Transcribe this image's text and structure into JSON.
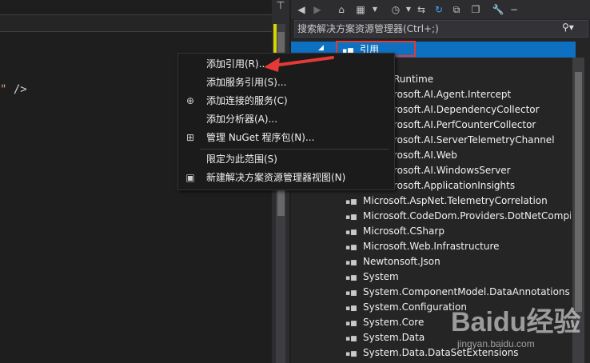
{
  "editor": {
    "code_tail": "\" />",
    "quote": "\"",
    "tag_close": "/>"
  },
  "splitter": {
    "pin_glyph": "⊤"
  },
  "toolbar": {
    "icons": [
      "back-icon",
      "forward-icon",
      "home-icon",
      "dropdown-icon",
      "history-icon",
      "sync-icon",
      "refresh-icon",
      "collapse-icon",
      "copy-icon",
      "wrench-icon",
      "minimize-icon"
    ]
  },
  "search": {
    "placeholder": "搜索解决方案资源管理器(Ctrl+;)"
  },
  "tree": {
    "selected": "引用",
    "items": [
      "Runtime",
      "rosoft.AI.Agent.Intercept",
      "rosoft.AI.DependencyCollector",
      "rosoft.AI.PerfCounterCollector",
      "rosoft.AI.ServerTelemetryChannel",
      "rosoft.AI.Web",
      "rosoft.AI.WindowsServer",
      "rosoft.ApplicationInsights",
      "Microsoft.AspNet.TelemetryCorrelation",
      "Microsoft.CodeDom.Providers.DotNetCompi",
      "Microsoft.CSharp",
      "Microsoft.Web.Infrastructure",
      "Newtonsoft.Json",
      "System",
      "System.ComponentModel.DataAnnotations",
      "System.Configuration",
      "System.Core",
      "System.Data",
      "System.Data.DataSetExtensions"
    ]
  },
  "menu": {
    "items": [
      {
        "label": "添加引用(R)...",
        "icon": ""
      },
      {
        "label": "添加服务引用(S)...",
        "icon": ""
      },
      {
        "label": "添加连接的服务(C)",
        "icon": "connected-service-icon"
      },
      {
        "label": "添加分析器(A)...",
        "icon": ""
      },
      {
        "label": "管理 NuGet 程序包(N)...",
        "icon": "nuget-icon"
      },
      {
        "label": "限定为此范围(S)",
        "icon": ""
      },
      {
        "label": "新建解决方案资源管理器视图(N)",
        "icon": "new-view-icon"
      }
    ]
  },
  "watermark": {
    "brand": "Baidu经验",
    "url": "jingyan.baidu.com"
  },
  "colors": {
    "selection": "#0e70c0",
    "highlight_box": "#e53935",
    "arrow": "#e53935"
  }
}
